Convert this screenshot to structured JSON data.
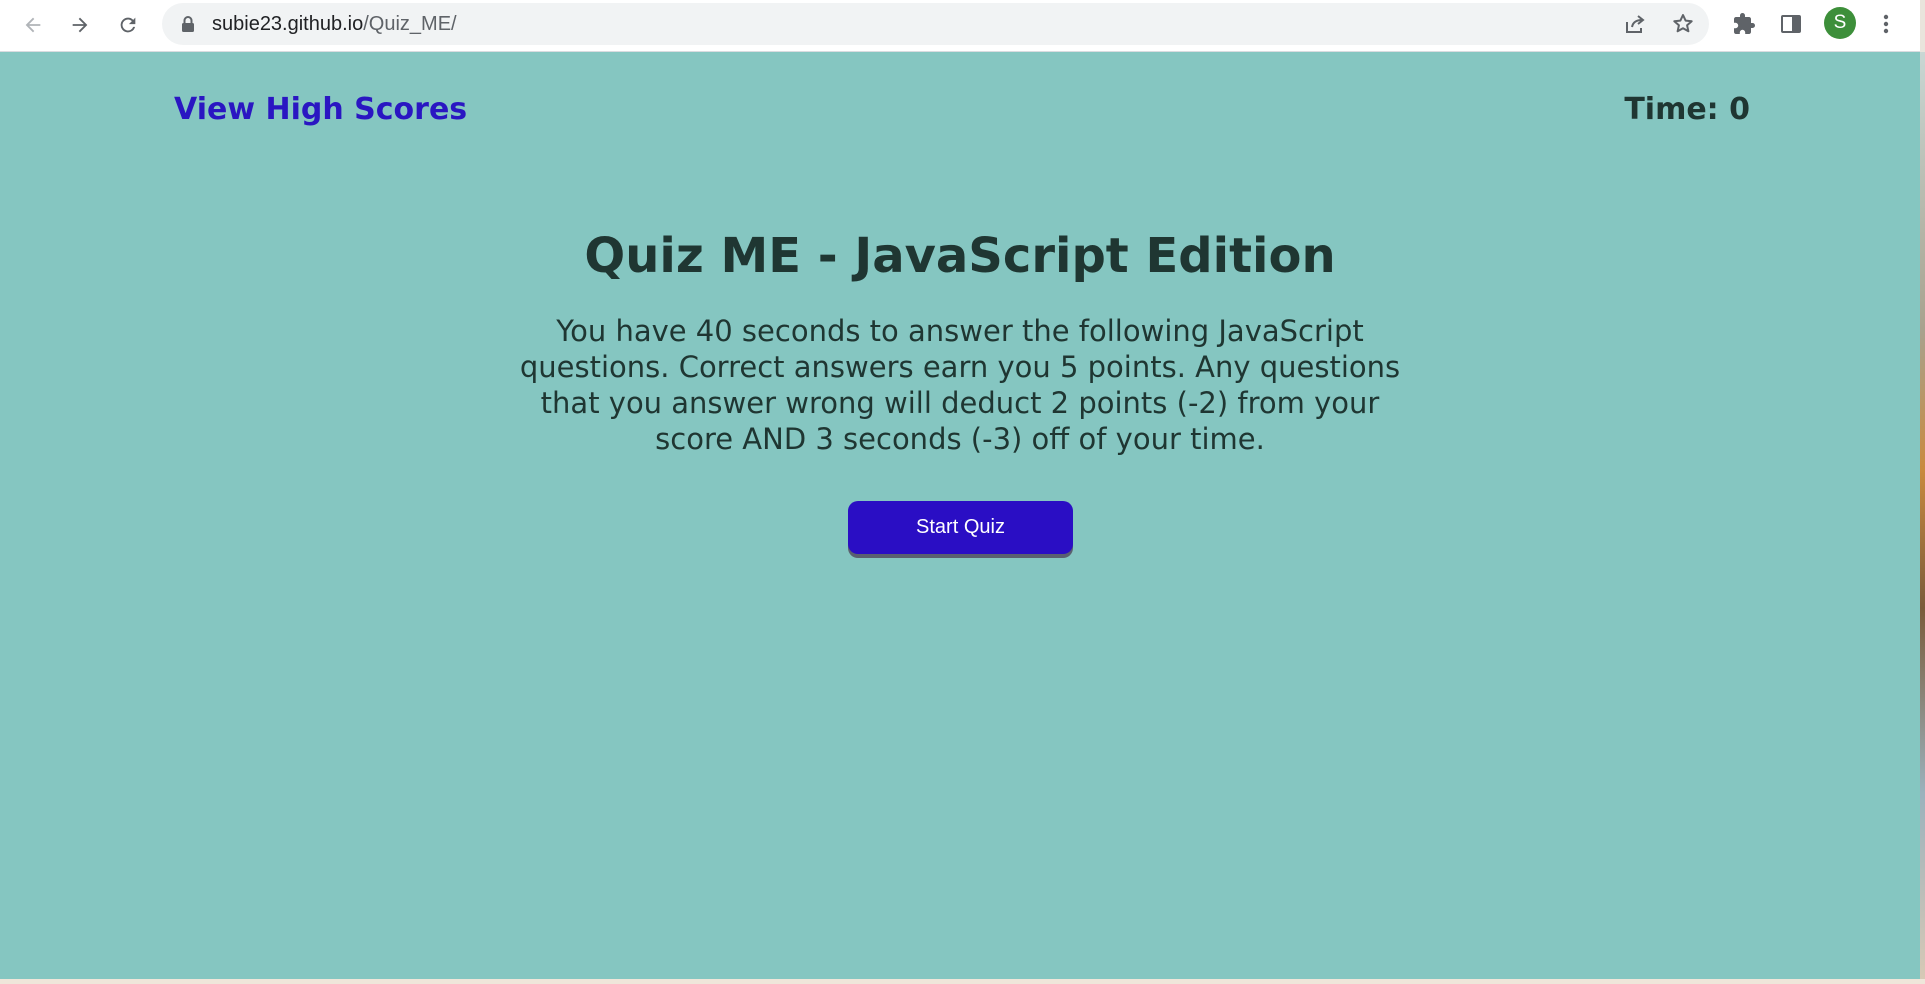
{
  "browser": {
    "url_host": "subie23.github.io",
    "url_path": "/Quiz_ME/",
    "profile_initial": "S",
    "icons": [
      "back-icon",
      "forward-icon",
      "reload-icon",
      "lock-icon",
      "share-icon",
      "bookmark-star-icon",
      "extensions-icon",
      "side-panel-icon",
      "menu-icon"
    ]
  },
  "header": {
    "high_scores_link": "View High Scores",
    "timer": "Time: 0"
  },
  "main": {
    "title": "Quiz ME - JavaScript Edition",
    "intro": "You have 40 seconds to answer the following JavaScript questions. Correct answers earn you 5 points. Any questions that you answer wrong will deduct 2 points (-2) from your score AND 3 seconds (-3) off of your time.",
    "start_button": "Start Quiz"
  },
  "colors": {
    "page_background": "#85c6c1",
    "accent": "#2a16c2",
    "button": "#2a0ec4",
    "text": "#1f3632"
  }
}
